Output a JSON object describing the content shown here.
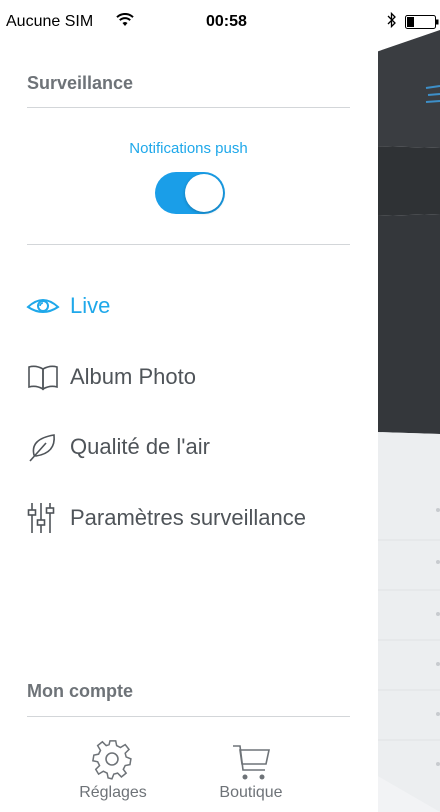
{
  "status_bar": {
    "carrier": "Aucune SIM",
    "time": "00:58"
  },
  "menu": {
    "section_surveillance": "Surveillance",
    "notifications_label": "Notifications push",
    "notifications_on": true,
    "items": [
      {
        "label": "Live",
        "icon": "eye-icon",
        "active": true
      },
      {
        "label": "Album Photo",
        "icon": "book-icon",
        "active": false
      },
      {
        "label": "Qualité de l'air",
        "icon": "leaf-icon",
        "active": false
      },
      {
        "label": "Paramètres surveillance",
        "icon": "sliders-icon",
        "active": false
      }
    ],
    "section_account": "Mon compte",
    "bottom": [
      {
        "label": "Réglages",
        "icon": "gear-icon"
      },
      {
        "label": "Boutique",
        "icon": "cart-icon"
      }
    ]
  },
  "colors": {
    "accent": "#1fa8ea",
    "toggle": "#1a9ee8",
    "text": "#4f5459",
    "section": "#6e7378"
  }
}
